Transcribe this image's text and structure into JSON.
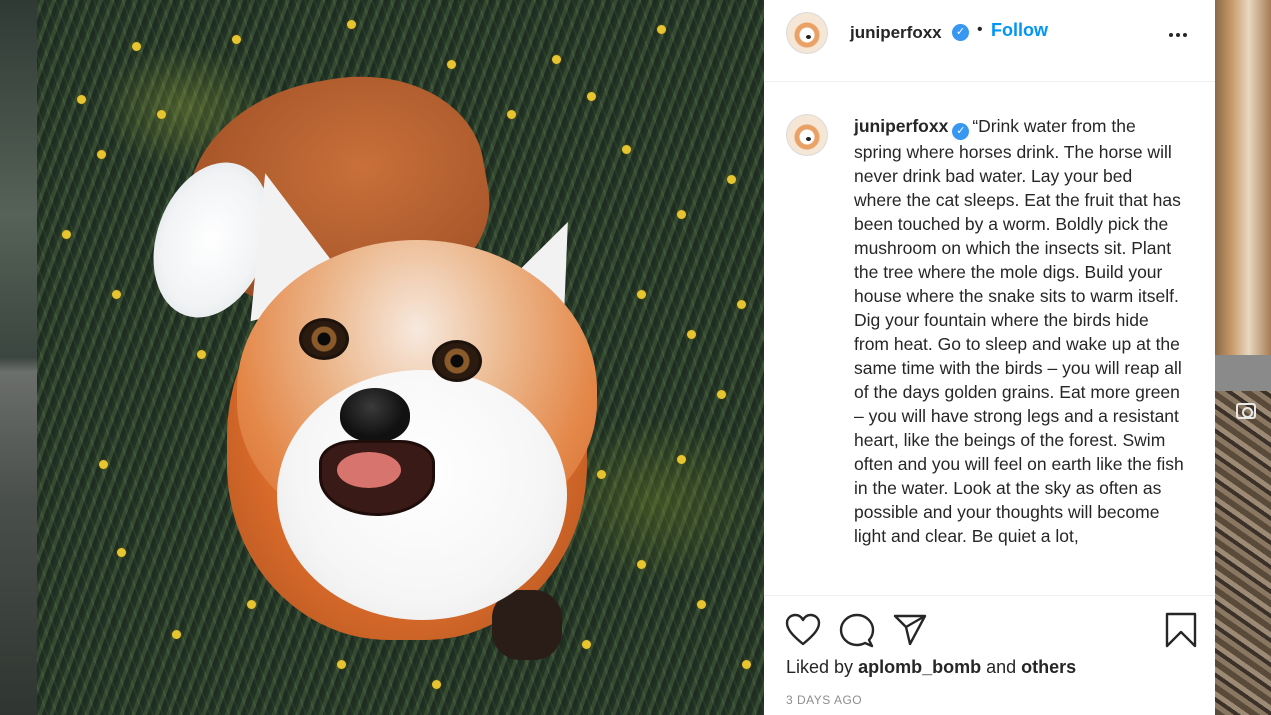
{
  "post": {
    "username": "juniperfoxx",
    "follow_label": "Follow",
    "separator": "•",
    "verified_icon": "verified-badge-icon"
  },
  "caption": {
    "username": "juniperfoxx",
    "text": "“Drink water from the spring where horses drink. The horse will never drink bad water. Lay your bed where the cat sleeps. Eat the fruit that has been touched by a worm. Boldly pick the mushroom on which the insects sit. Plant the tree where the mole digs. Build your house where the snake sits to warm itself. Dig your fountain where the birds hide from heat. Go to sleep and wake up at the same time with the birds – you will reap all of the days golden grains. Eat more green – you will have strong legs and a resistant heart, like the beings of the forest. Swim often and you will feel on earth like the fish in the water. Look at the sky as often as possible and your thoughts will become light and clear. Be quiet a lot,"
  },
  "engagement": {
    "liked_by_prefix": "Liked by",
    "liked_by_user": "aplomb_bomb",
    "liked_by_and": "and",
    "liked_by_others": "others",
    "timestamp": "3 DAYS AGO"
  },
  "colors": {
    "link": "#0095f6",
    "verified": "#3897f0",
    "text": "#262626",
    "muted": "#8e8e8e"
  }
}
